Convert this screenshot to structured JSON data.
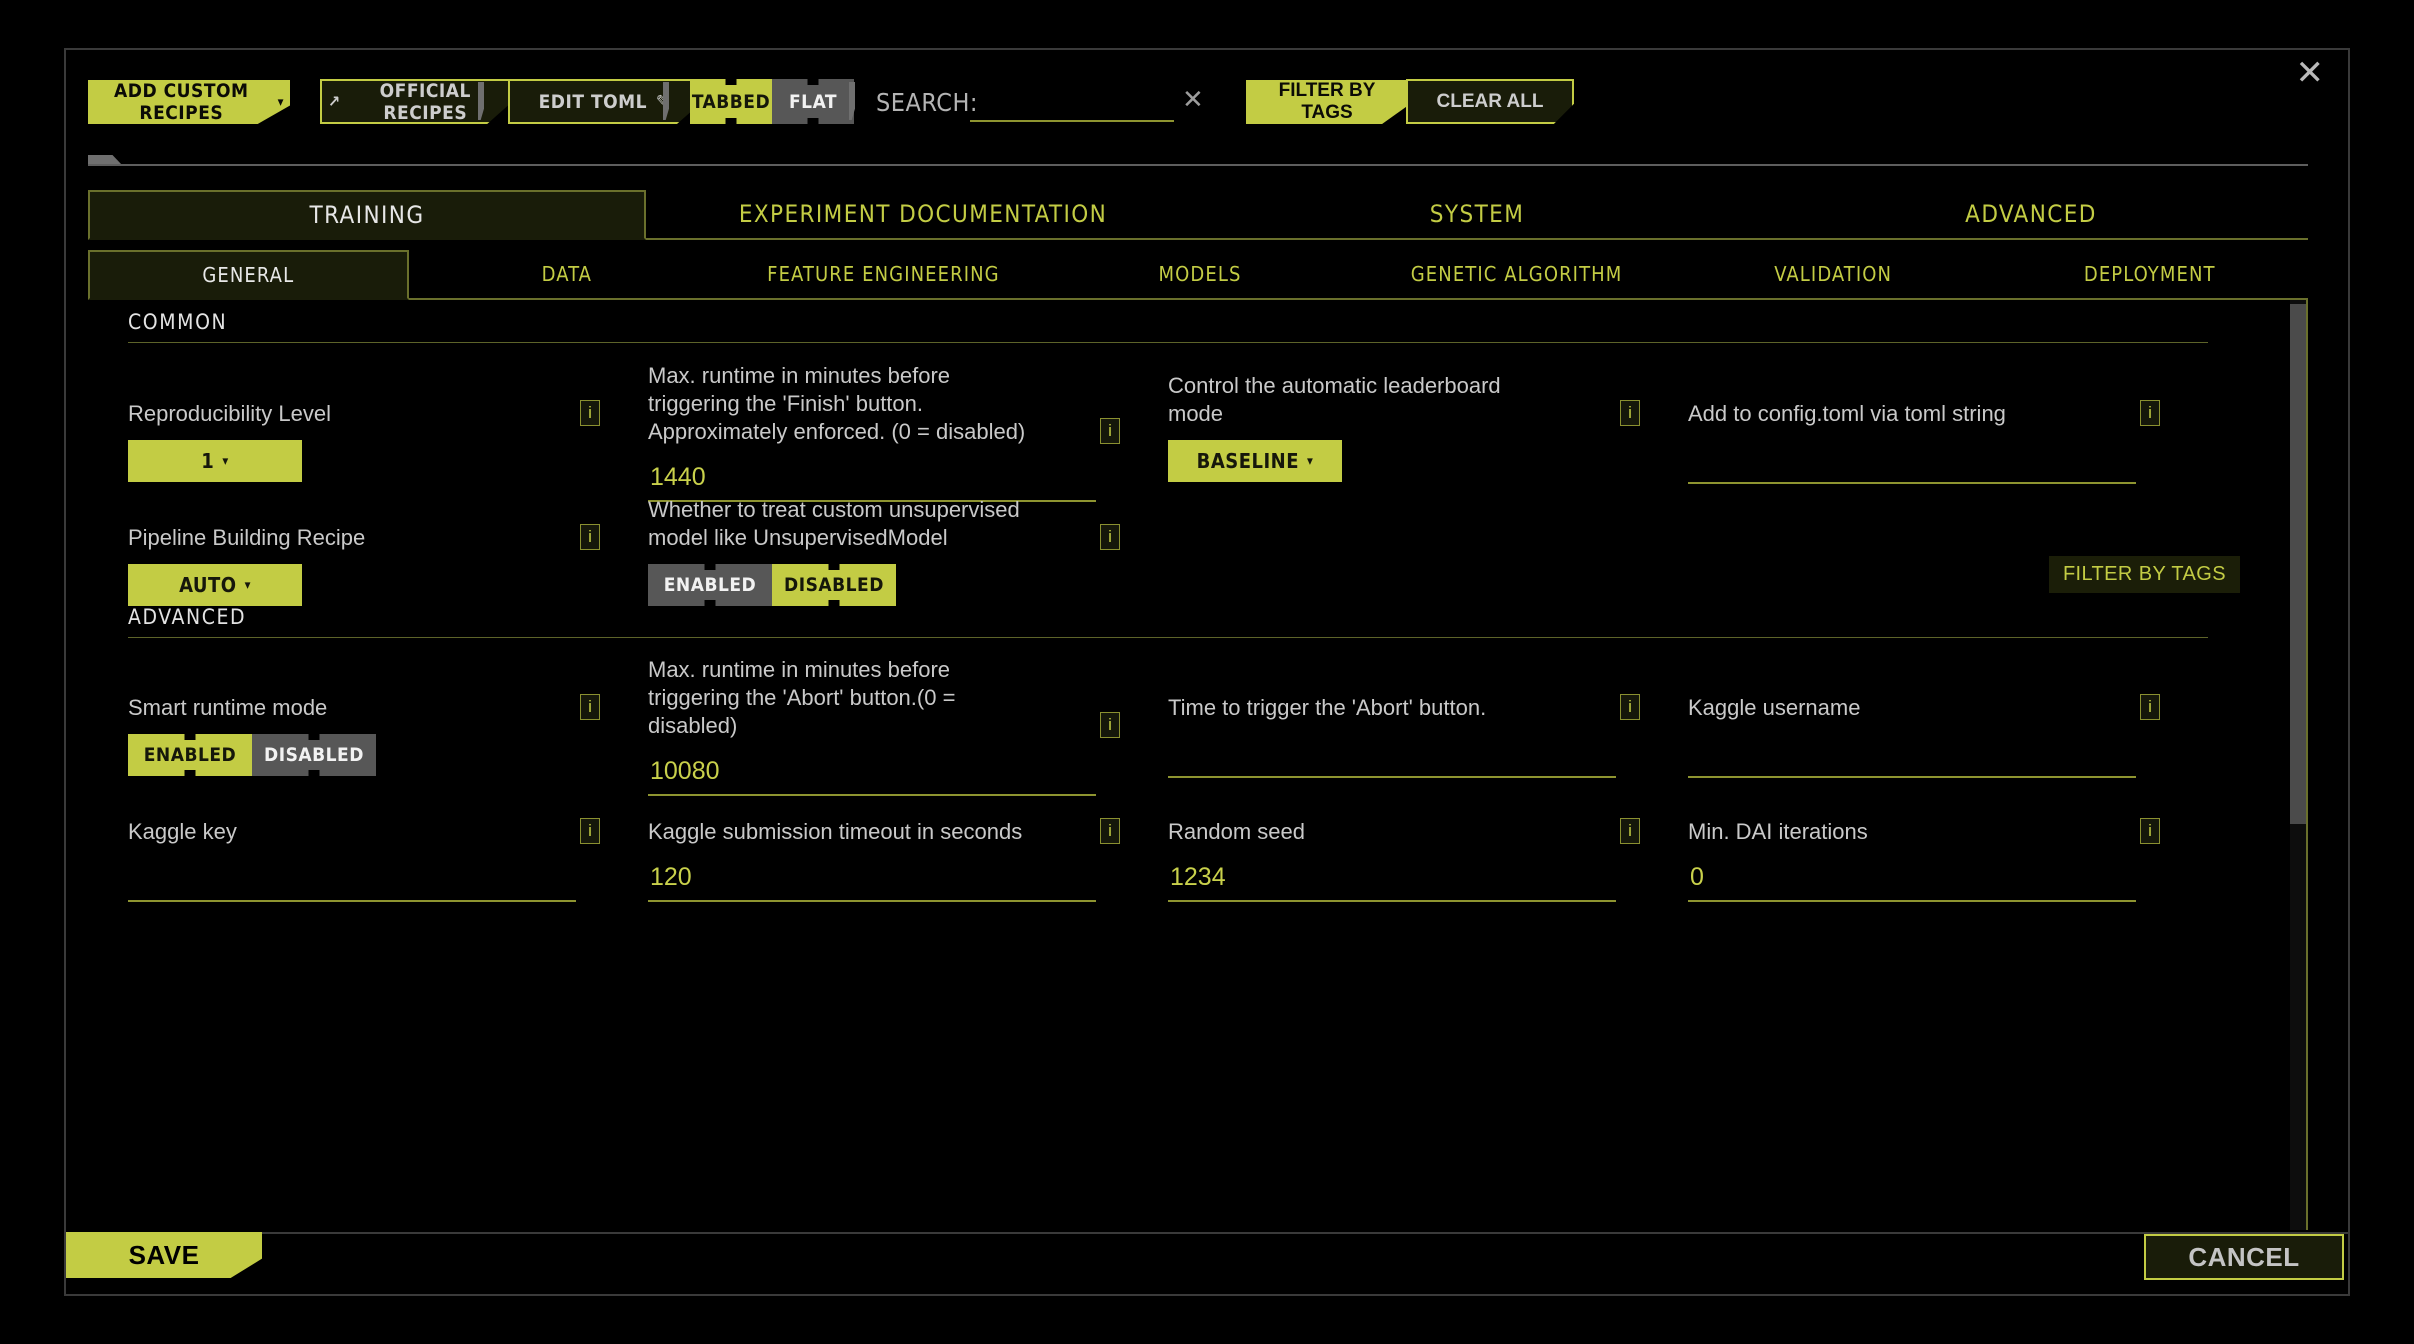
{
  "theme": {
    "accent": "#c3cc44",
    "accent_dim": "#8e9430",
    "panel_bg": "#191c09",
    "bg": "#000000",
    "label_text": "#c9c9c9",
    "value_text": "#c9d14b",
    "toggle_off_bg": "#575757"
  },
  "toolbar": {
    "add_custom_recipes": "ADD CUSTOM RECIPES",
    "add_custom_recipes_caret": "▾",
    "official_recipes": "OFFICIAL RECIPES",
    "official_recipes_icon": "↗",
    "edit_toml": "EDIT TOML",
    "edit_toml_icon": "✎",
    "view_modes": [
      {
        "label": "TABBED",
        "selected": true
      },
      {
        "label": "FLAT",
        "selected": false
      }
    ],
    "search_label": "SEARCH:",
    "search_value": "",
    "search_placeholder": "",
    "search_clear_icon": "✕",
    "filter_by_tags": "FILTER BY TAGS",
    "clear_all": "CLEAR ALL",
    "close_icon": "✕"
  },
  "primary_tabs": [
    {
      "label": "TRAINING",
      "active": true
    },
    {
      "label": "EXPERIMENT DOCUMENTATION",
      "active": false
    },
    {
      "label": "SYSTEM",
      "active": false
    },
    {
      "label": "ADVANCED",
      "active": false
    }
  ],
  "sub_tabs": [
    {
      "label": "GENERAL",
      "active": true
    },
    {
      "label": "DATA",
      "active": false
    },
    {
      "label": "FEATURE ENGINEERING",
      "active": false
    },
    {
      "label": "MODELS",
      "active": false
    },
    {
      "label": "GENETIC ALGORITHM",
      "active": false
    },
    {
      "label": "VALIDATION",
      "active": false
    },
    {
      "label": "DEPLOYMENT",
      "active": false
    }
  ],
  "panel": {
    "filter_by_tags": "FILTER BY TAGS",
    "info_icon": "i",
    "caret": "▾",
    "sections": [
      {
        "title": "COMMON",
        "rows": [
          [
            {
              "label": "Reproducibility Level",
              "control": "dropdown",
              "value": "1"
            },
            {
              "label": "Max. runtime in minutes before triggering the 'Finish' button. Approximately enforced. (0 = disabled)",
              "control": "text",
              "value": "1440"
            },
            {
              "label": "Control the automatic leaderboard mode",
              "control": "dropdown",
              "value": "BASELINE"
            },
            {
              "label": "Add to config.toml via toml string",
              "control": "text",
              "value": ""
            }
          ],
          [
            {
              "label": "Pipeline Building Recipe",
              "control": "dropdown",
              "value": "AUTO"
            },
            {
              "label": "Whether to treat custom unsupervised model like UnsupervisedModel",
              "control": "toggle",
              "options": [
                {
                  "label": "ENABLED",
                  "selected": false
                },
                {
                  "label": "DISABLED",
                  "selected": true
                }
              ]
            },
            {
              "label": "",
              "control": "none"
            },
            {
              "label": "",
              "control": "none"
            }
          ]
        ]
      },
      {
        "title": "ADVANCED",
        "rows": [
          [
            {
              "label": "Smart runtime mode",
              "control": "toggle",
              "options": [
                {
                  "label": "ENABLED",
                  "selected": true
                },
                {
                  "label": "DISABLED",
                  "selected": false
                }
              ]
            },
            {
              "label": "Max. runtime in minutes before triggering the 'Abort' button.(0 = disabled)",
              "control": "text",
              "value": "10080"
            },
            {
              "label": "Time to trigger the 'Abort' button.",
              "control": "text",
              "value": ""
            },
            {
              "label": "Kaggle username",
              "control": "text",
              "value": ""
            }
          ],
          [
            {
              "label": "Kaggle key",
              "control": "text",
              "value": ""
            },
            {
              "label": "Kaggle submission timeout in seconds",
              "control": "text",
              "value": "120"
            },
            {
              "label": "Random seed",
              "control": "text",
              "value": "1234"
            },
            {
              "label": "Min. DAI iterations",
              "control": "text",
              "value": "0"
            }
          ]
        ]
      }
    ]
  },
  "footer": {
    "save": "SAVE",
    "cancel": "CANCEL"
  }
}
